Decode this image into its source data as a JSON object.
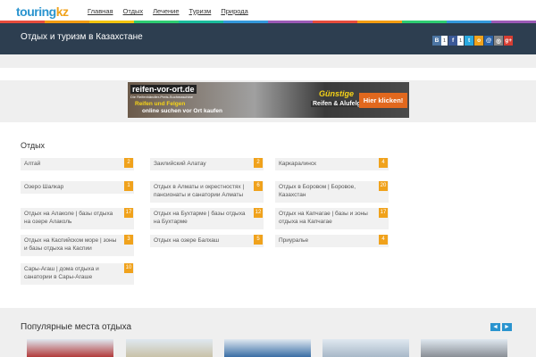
{
  "logo": {
    "part1": "touring",
    "part2": "kz"
  },
  "nav": [
    "Главная",
    "Отдых",
    "Лечение",
    "Туризм",
    "Природа"
  ],
  "stripe_colors": [
    "#e74c3c",
    "#f39c12",
    "#f1c40f",
    "#2ecc71",
    "#1abc9c",
    "#3498db",
    "#9b59b6",
    "#e74c3c",
    "#f39c12",
    "#2ecc71",
    "#3498db",
    "#9b59b6"
  ],
  "hero": {
    "title": "Отдых и туризм в Казахстане"
  },
  "share": {
    "vk_icon": "В",
    "vk_count": "1",
    "fb_icon": "f",
    "fb_count": "1",
    "buttons": [
      {
        "icon": "twitter-icon",
        "glyph": "t",
        "color": "#2aa9e0"
      },
      {
        "icon": "odnoklassniki-icon",
        "glyph": "о",
        "color": "#f0a21c"
      },
      {
        "icon": "moimir-icon",
        "glyph": "@",
        "color": "#2a62a8"
      },
      {
        "icon": "livejournal-icon",
        "glyph": "◎",
        "color": "#888888"
      },
      {
        "icon": "googleplus-icon",
        "glyph": "g+",
        "color": "#d73d32"
      }
    ]
  },
  "ad": {
    "domain": "reifen-vor-ort.de",
    "tagline": "Die Reifenhändler-Preis-Suchmaschine",
    "line1": "Reifen und Felgen",
    "line2": "online suchen vor Ort kaufen",
    "promo1": "Günstige",
    "promo2": "Reifen & Alufelgen",
    "cta": "Hier klicken!"
  },
  "section": {
    "title": "Отдых"
  },
  "cards": [
    {
      "label": "Алтай",
      "count": "2"
    },
    {
      "label": "Заилийский Алатау",
      "count": "2"
    },
    {
      "label": "Каркаралинск",
      "count": "4"
    },
    {
      "label": "Озеро Шалкар",
      "count": "1"
    },
    {
      "label": "Отдых в Алматы и окрестностях | пансионаты и санатории Алматы",
      "count": "6"
    },
    {
      "label": "Отдых в Боровом | Боровое, Казахстан",
      "count": "20"
    },
    {
      "label": "Отдых на Алаколе | базы отдыха на озере Алаколь",
      "count": "17"
    },
    {
      "label": "Отдых на Бухтарме | базы отдыха на Бухтарме",
      "count": "12"
    },
    {
      "label": "Отдых на Капчагае | базы и зоны отдыха на Капчагае",
      "count": "17"
    },
    {
      "label": "Отдых на Каспийском море | зоны и базы отдыха на Каспии",
      "count": "3"
    },
    {
      "label": "Отдых на озере Балхаш",
      "count": "5"
    },
    {
      "label": "Приуралье",
      "count": "4"
    },
    {
      "label": "Сары-Агаш | дома отдыха и санатории в Сары-Агаше",
      "count": "10"
    }
  ],
  "popular": {
    "title": "Популярные места отдыха",
    "prev": "◄",
    "next": "►"
  },
  "thumb_colors": [
    "#b23a3a",
    "#c9c2a8",
    "#3a6ea5",
    "#a8b8c8",
    "#8a8f96"
  ]
}
